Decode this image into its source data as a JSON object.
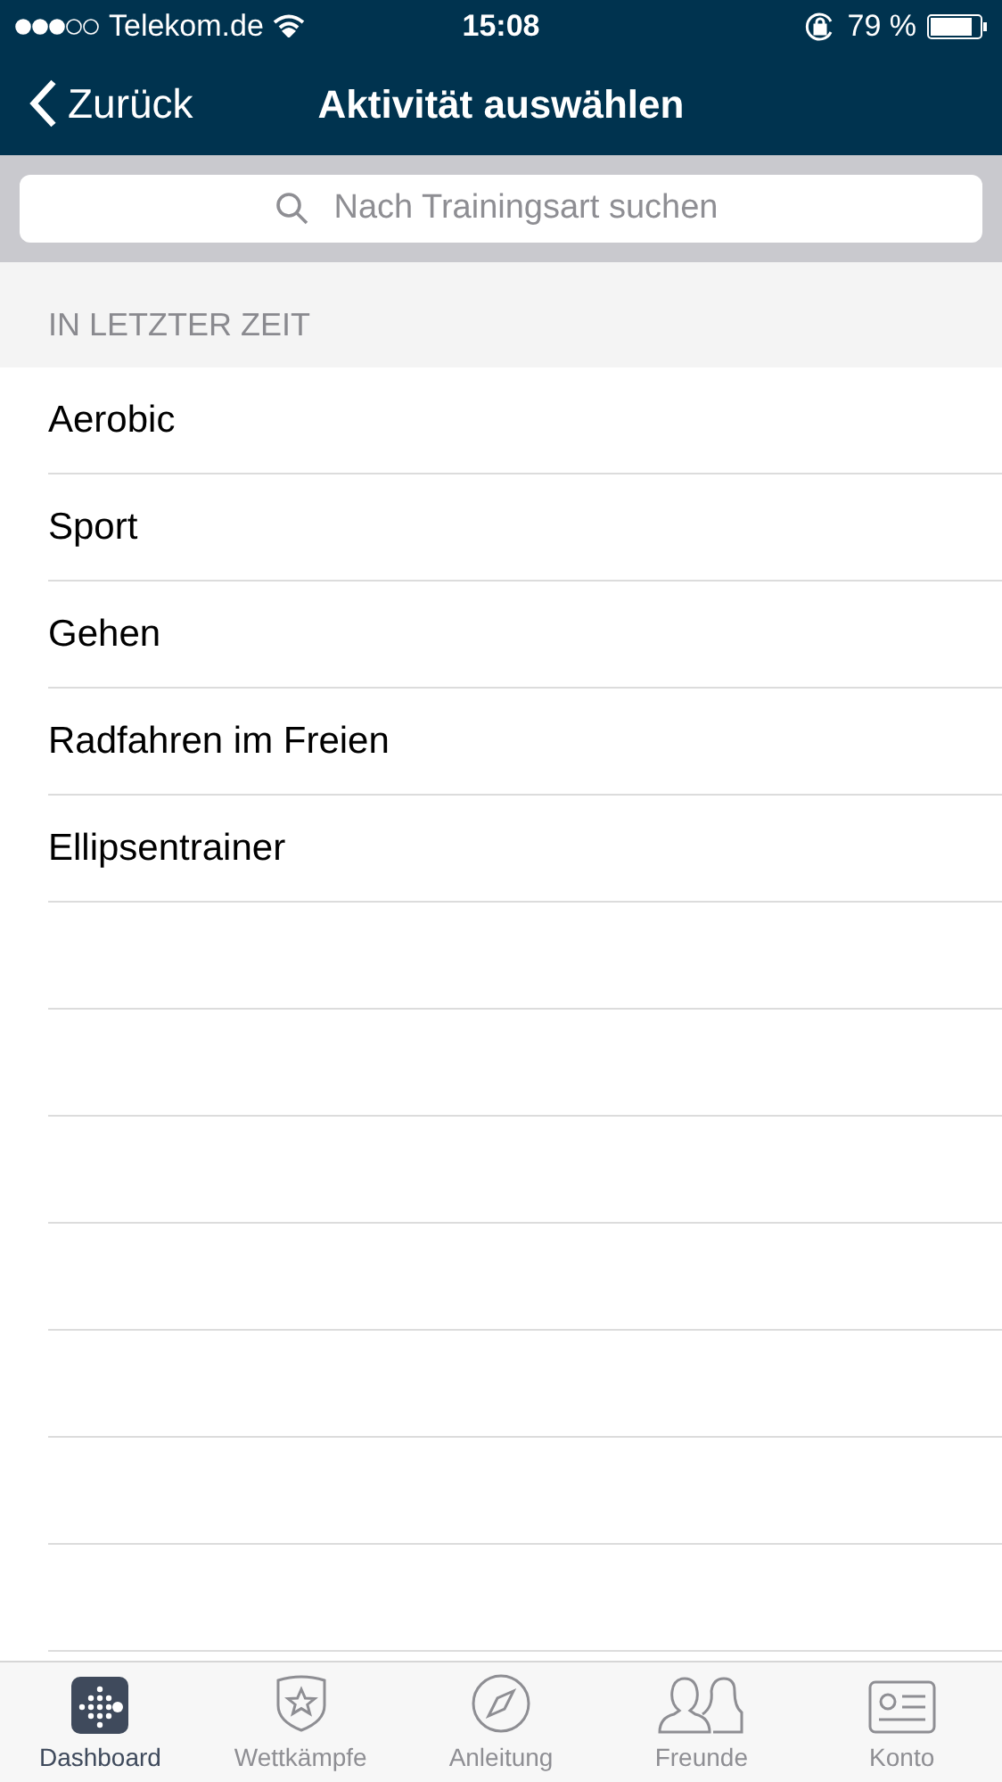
{
  "status_bar": {
    "carrier": "Telekom.de",
    "time": "15:08",
    "battery": "79 %"
  },
  "nav": {
    "back": "Zurück",
    "title": "Aktivität auswählen"
  },
  "search": {
    "placeholder": "Nach Trainingsart suchen"
  },
  "section": {
    "title": "IN LETZTER ZEIT"
  },
  "items": [
    "Aerobic",
    "Sport",
    "Gehen",
    "Radfahren im Freien",
    "Ellipsentrainer"
  ],
  "tabs": [
    {
      "label": "Dashboard",
      "kind": "dashboard",
      "selected": true
    },
    {
      "label": "Wettkämpfe",
      "kind": "challenges",
      "selected": false
    },
    {
      "label": "Anleitung",
      "kind": "guide",
      "selected": false
    },
    {
      "label": "Freunde",
      "kind": "friends",
      "selected": false
    },
    {
      "label": "Konto",
      "kind": "account",
      "selected": false
    }
  ]
}
